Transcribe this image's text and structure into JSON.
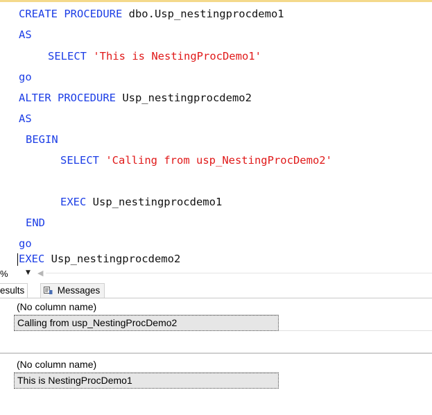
{
  "editor": {
    "lines": [
      [
        {
          "t": "CREATE PROCEDURE",
          "c": "kw"
        },
        {
          "t": " dbo.Usp_nestingprocdemo1",
          "c": "id"
        }
      ],
      [
        {
          "t": "AS",
          "c": "kw"
        }
      ],
      [
        {
          "t": "SELECT",
          "c": "kw"
        },
        {
          "t": " ",
          "c": "id"
        },
        {
          "t": "'This is NestingProcDemo1'",
          "c": "str"
        }
      ],
      [
        {
          "t": "go",
          "c": "kw"
        }
      ],
      [
        {
          "t": "ALTER PROCEDURE",
          "c": "kw"
        },
        {
          "t": " Usp_nestingprocdemo2",
          "c": "id"
        }
      ],
      [
        {
          "t": "AS",
          "c": "kw"
        }
      ],
      [
        {
          "t": "BEGIN",
          "c": "kw"
        }
      ],
      [
        {
          "t": "SELECT",
          "c": "kw"
        },
        {
          "t": " ",
          "c": "id"
        },
        {
          "t": "'Calling from usp_NestingProcDemo2'",
          "c": "str"
        }
      ],
      [],
      [
        {
          "t": "EXEC",
          "c": "kw"
        },
        {
          "t": " Usp_nestingprocdemo1",
          "c": "id"
        }
      ],
      [
        {
          "t": "END",
          "c": "kw"
        }
      ],
      [
        {
          "t": "go",
          "c": "kw"
        }
      ],
      [
        {
          "t": "EXEC",
          "c": "kw"
        },
        {
          "t": " Usp_nestingprocdemo2",
          "c": "id"
        }
      ]
    ]
  },
  "zoom": {
    "value": "%",
    "dropdown_icon": "chevron-down-icon",
    "scroll_icon": "scroll-left-icon"
  },
  "tabs": {
    "results_label": "esults",
    "messages_label": "Messages",
    "messages_icon": "messages-icon"
  },
  "results": [
    {
      "header": "(No column name)",
      "rows": [
        "Calling from usp_NestingProcDemo2"
      ]
    },
    {
      "header": "(No column name)",
      "rows": [
        "This is NestingProcDemo1"
      ]
    }
  ],
  "colors": {
    "keyword": "#1c3ee6",
    "identifier": "#111111",
    "string": "#e01919",
    "selected_cell": "#e6e6e6"
  }
}
